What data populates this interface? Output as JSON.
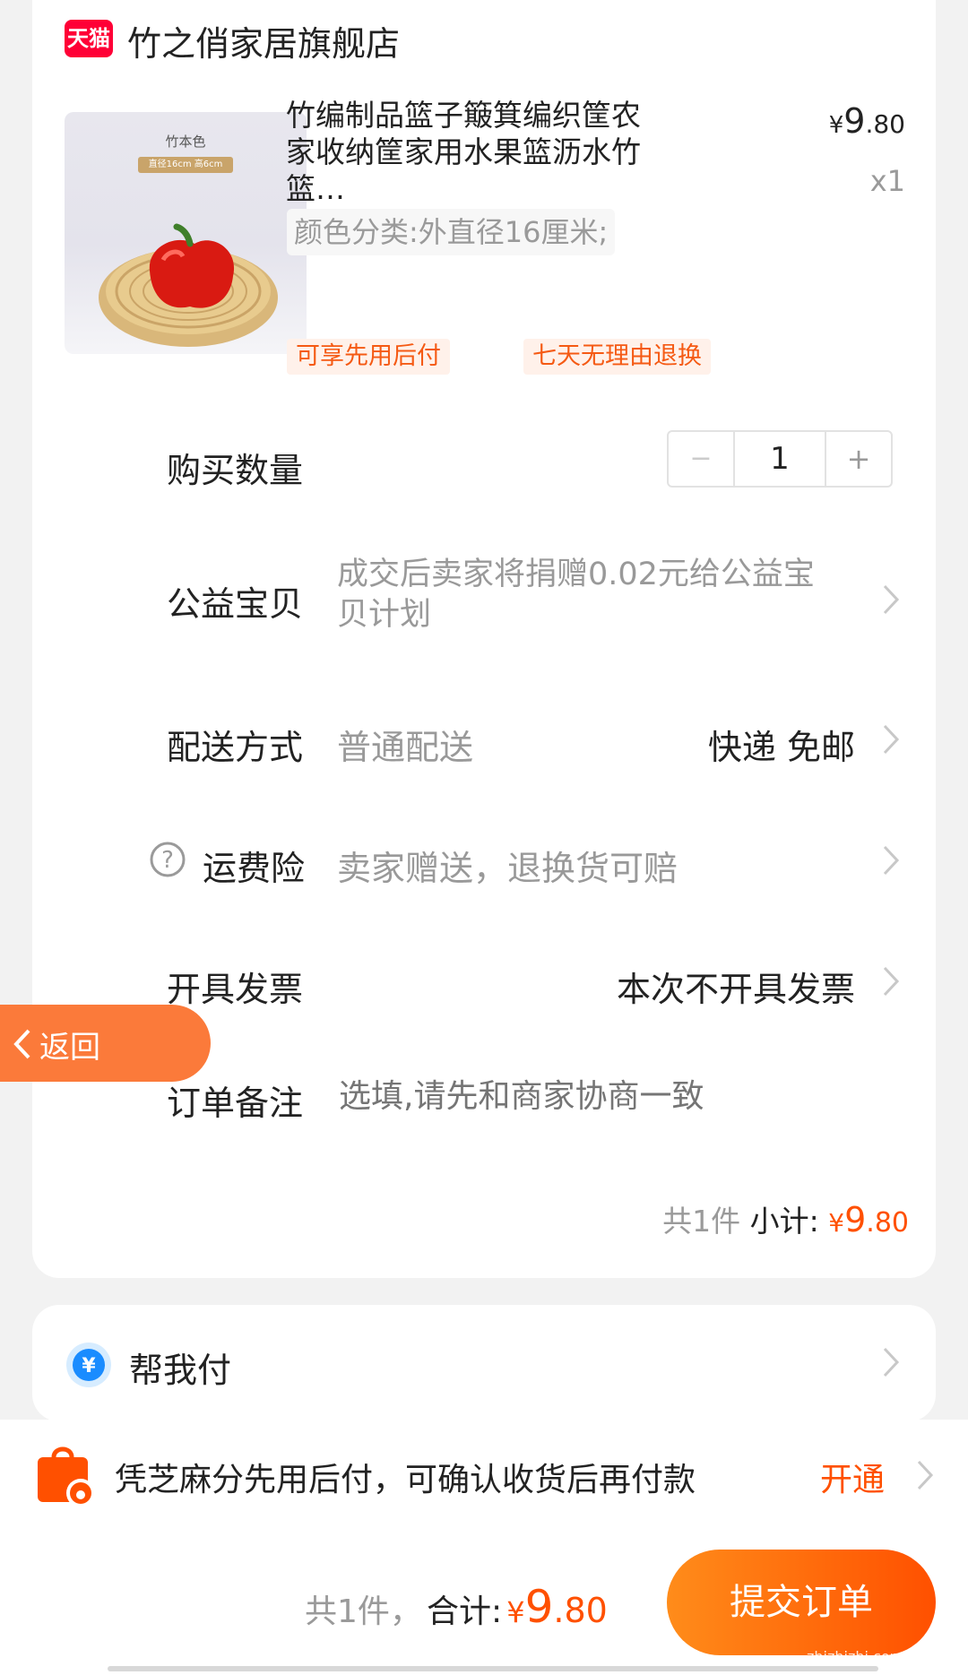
{
  "store": {
    "brand_badge": "天猫",
    "name": "竹之俏家居旗舰店"
  },
  "product": {
    "image_caption": "竹本色",
    "image_subcaption": "直径16cm 高6cm",
    "title": "竹编制品篮子簸箕编织筐农家收纳筐家用水果篮沥水竹篮…",
    "price_symbol": "¥",
    "price_int": "9",
    "price_dec": ".80",
    "qty": "x1",
    "spec": "颜色分类:外直径16厘米;",
    "tags": [
      "可享先用后付",
      "七天无理由退换"
    ]
  },
  "quantity": {
    "label": "购买数量",
    "minus": "−",
    "value": "1",
    "plus": "+"
  },
  "charity": {
    "label": "公益宝贝",
    "value": "成交后卖家将捐赠0.02元给公益宝贝计划"
  },
  "delivery": {
    "label": "配送方式",
    "value": "普通配送",
    "detail": "快递 免邮"
  },
  "insurance": {
    "label": "运费险",
    "value": "卖家赠送，退换货可赔"
  },
  "invoice": {
    "label": "开具发票",
    "value": "本次不开具发票"
  },
  "back": {
    "label": "返回"
  },
  "remark": {
    "label": "订单备注",
    "placeholder": "选填,请先和商家协商一致"
  },
  "subtotal": {
    "count": "共1件",
    "label": "小计:",
    "symbol": "¥",
    "int": "9",
    "dec": ".80"
  },
  "helppay": {
    "label": "帮我付"
  },
  "zhima": {
    "text": "凭芝麻分先用后付，可确认收货后再付款",
    "action": "开通"
  },
  "footer": {
    "count": "共1件，",
    "label": "合计:",
    "symbol": "¥",
    "int": "9",
    "dec": ".80",
    "submit": "提交订单"
  },
  "watermark": {
    "text": "zhizhizhi.com"
  },
  "colors": {
    "accent": "#ff5000",
    "tmall_red": "#ff0036",
    "bg": "#f2f2f2"
  }
}
